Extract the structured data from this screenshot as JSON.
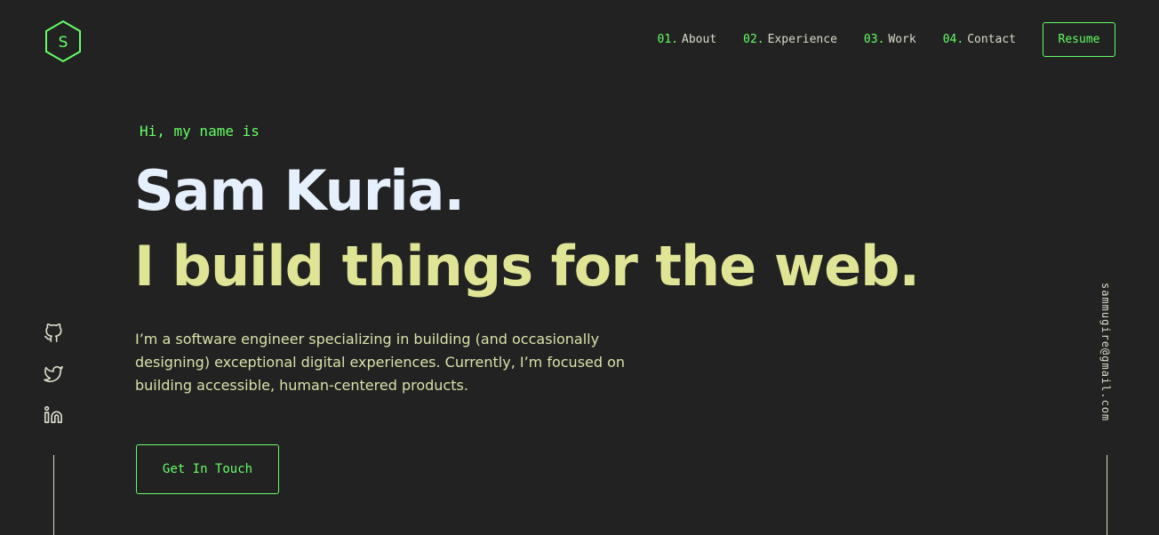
{
  "brand": {
    "logo_letter": "S",
    "accent_color": "#64ff64"
  },
  "nav": {
    "items": [
      {
        "num": "01.",
        "label": "About"
      },
      {
        "num": "02.",
        "label": "Experience"
      },
      {
        "num": "03.",
        "label": "Work"
      },
      {
        "num": "04.",
        "label": "Contact"
      }
    ],
    "resume_label": "Resume"
  },
  "hero": {
    "intro": "Hi, my name is",
    "name": "Sam Kuria.",
    "tagline": "I build things for the web.",
    "description": "I’m a software engineer specializing in building (and occasionally designing) exceptional digital experiences. Currently, I’m focused on building accessible, human-centered products.",
    "cta_label": "Get In Touch"
  },
  "social": {
    "icons": [
      "github-icon",
      "twitter-icon",
      "linkedin-icon"
    ]
  },
  "email": "sammugire@gmail.com",
  "colors": {
    "background": "#222222",
    "name": "#e6effc",
    "tagline": "#e0e595",
    "text": "#d9e2a8"
  }
}
